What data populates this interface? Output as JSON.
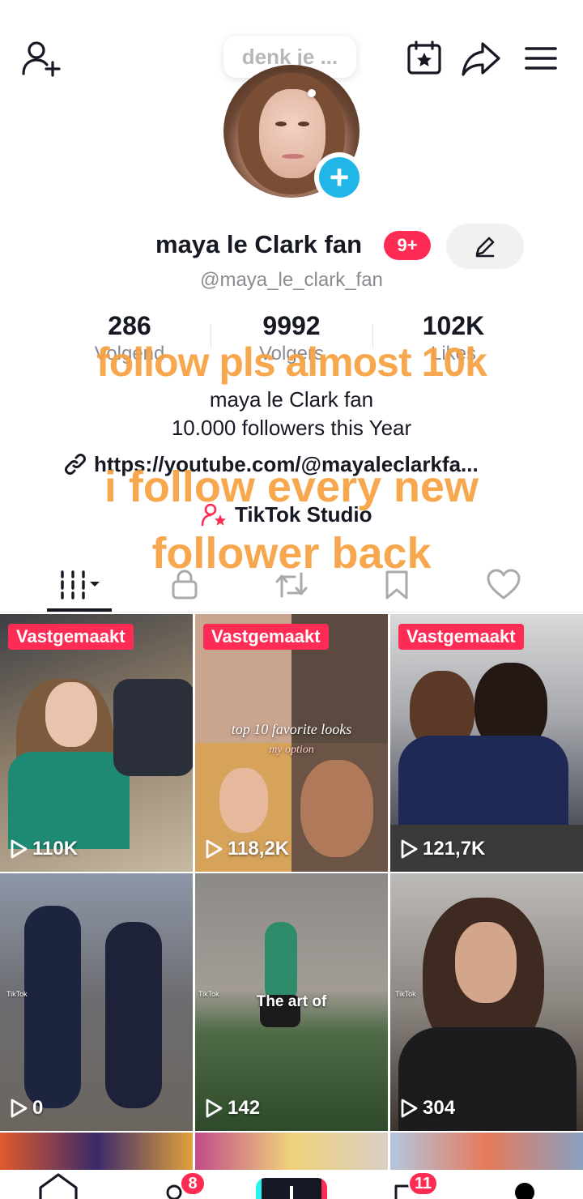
{
  "header": {
    "story_bubble": "denk je ..."
  },
  "profile": {
    "display_name": "maya le Clark fan",
    "notification_badge": "9+",
    "handle": "@maya_le_clark_fan",
    "stats": [
      {
        "value": "286",
        "label": "Volgend"
      },
      {
        "value": "9992",
        "label": "Volgers"
      },
      {
        "value": "102K",
        "label": "Likes"
      }
    ],
    "bio_line1": "maya le Clark fan",
    "bio_line2": "10.000 followers this Year",
    "link": "https://youtube.com/@mayaleclarkfa...",
    "studio": "TikTok Studio"
  },
  "overlay_text": {
    "line1": "follow pls almost 10k",
    "line2": "i follow every new",
    "line3": "follower back"
  },
  "tabs": [
    {
      "name": "videos-grid-tab",
      "icon": "grid-icon",
      "active": true
    },
    {
      "name": "private-tab",
      "icon": "lock-icon"
    },
    {
      "name": "reposts-tab",
      "icon": "repost-icon"
    },
    {
      "name": "favorites-tab",
      "icon": "bookmark-icon"
    },
    {
      "name": "liked-tab",
      "icon": "heart-icon"
    }
  ],
  "videos": [
    {
      "pinned_label": "Vastgemaakt",
      "views": "110K"
    },
    {
      "pinned_label": "Vastgemaakt",
      "views": "118,2K",
      "caption": "top 10 favorite looks",
      "subcaption": "my option"
    },
    {
      "pinned_label": "Vastgemaakt",
      "views": "121,7K"
    },
    {
      "views": "0",
      "watermark": "TikTok"
    },
    {
      "views": "142",
      "caption": "The art of",
      "watermark": "TikTok"
    },
    {
      "views": "304",
      "watermark": "TikTok"
    }
  ],
  "bottom_nav": {
    "friends_badge": "8",
    "inbox_badge": "11"
  },
  "colors": {
    "accent": "#fe2c55",
    "overlay_text": "#f7a13f",
    "follow_plus": "#20b6e8"
  }
}
